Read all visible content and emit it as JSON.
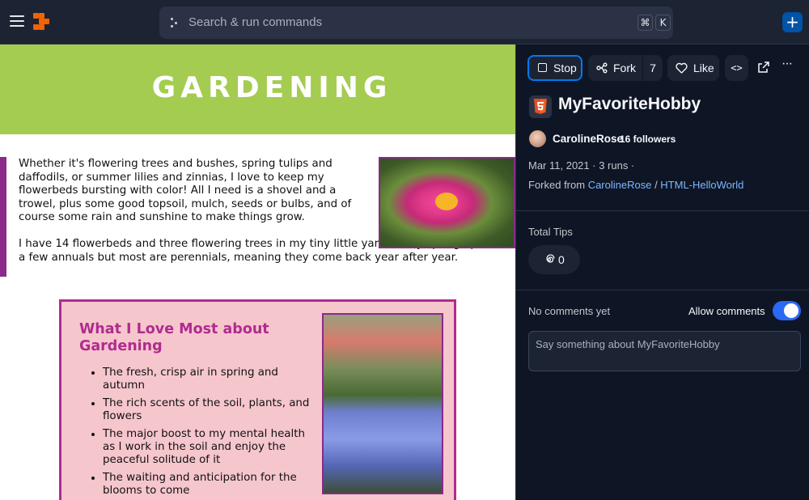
{
  "topbar": {
    "search_placeholder": "Search & run commands",
    "shortcut_cmd": "⌘",
    "shortcut_key": "K",
    "plus_label": "+"
  },
  "content": {
    "banner_title": "GARDENING",
    "paragraph1": "Whether it's flowering trees and bushes, spring tulips and daffodils, or summer lilies and zinnias, I love to keep my flowerbeds bursting with color! All I need is a shovel and a trowel, plus some good topsoil, mulch, seeds or bulbs, and of course some rain and sunshine to make things grow.",
    "paragraph2": "I have 14 flowerbeds and three flowering trees in my tiny little yard. Every spring I plant a few annuals but most are perennials, meaning they come back year after year.",
    "box_heading": "What I Love Most about Gardening",
    "box_items": [
      "The fresh, crisp air in spring and autumn",
      "The rich scents of the soil, plants, and flowers",
      "The major boost to my mental health as I work in the soil and enjoy the peaceful solitude of it",
      "The waiting and anticipation for the blooms to come"
    ]
  },
  "sidebar": {
    "stop_label": "Stop",
    "fork_label": "Fork",
    "fork_count": "7",
    "like_label": "Like",
    "code_label": "<>",
    "more_label": "···",
    "repl_title": "MyFavoriteHobby",
    "author": "CarolineRose",
    "followers": "16 followers",
    "meta": "Mar 11, 2021 · 3 runs ·",
    "forked_prefix": "Forked from ",
    "forked_user": "CarolineRose",
    "forked_sep": " / ",
    "forked_repl": "HTML-HelloWorld",
    "tips_label": "Total Tips",
    "tips_value": "0",
    "no_comments": "No comments yet",
    "allow_comments": "Allow comments",
    "comment_placeholder": "Say something about MyFavoriteHobby"
  },
  "colors": {
    "banner": "#a4cc50",
    "accent_purple": "#8b2a8a",
    "box_pink": "#f6c6cd",
    "heading_magenta": "#b02b8f",
    "primary_blue": "#0079f2",
    "link_blue": "#7cb8ff",
    "logo_orange": "#f26207"
  }
}
